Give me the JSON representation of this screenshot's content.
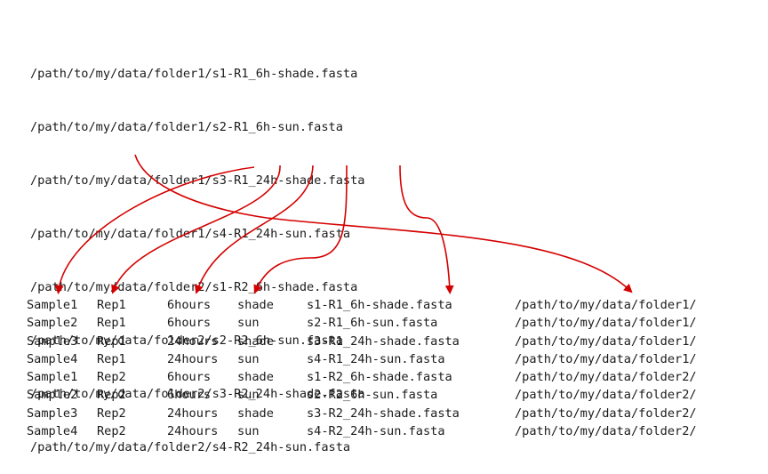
{
  "paths": [
    "/path/to/my/data/folder1/s1-R1_6h-shade.fasta",
    "/path/to/my/data/folder1/s2-R1_6h-sun.fasta",
    "/path/to/my/data/folder1/s3-R1_24h-shade.fasta",
    "/path/to/my/data/folder1/s4-R1_24h-sun.fasta",
    "/path/to/my/data/folder2/s1-R2_6h-shade.fasta",
    "/path/to/my/data/folder2/s2-R2_6h-sun.fasta",
    "/path/to/my/data/folder2/s3-R2_24h-shade.fasta",
    "/path/to/my/data/folder2/s4-R2_24h-sun.fasta"
  ],
  "table": [
    [
      "Sample1",
      "Rep1",
      "6hours",
      "shade",
      "s1-R1_6h-shade.fasta",
      "/path/to/my/data/folder1/"
    ],
    [
      "Sample2",
      "Rep1",
      "6hours",
      "sun",
      "s2-R1_6h-sun.fasta",
      "/path/to/my/data/folder1/"
    ],
    [
      "Sample3",
      "Rep1",
      "24hours",
      "shade",
      "s3-R1_24h-shade.fasta",
      "/path/to/my/data/folder1/"
    ],
    [
      "Sample4",
      "Rep1",
      "24hours",
      "sun",
      "s4-R1_24h-sun.fasta",
      "/path/to/my/data/folder1/"
    ],
    [
      "Sample1",
      "Rep2",
      "6hours",
      "shade",
      "s1-R2_6h-shade.fasta",
      "/path/to/my/data/folder2/"
    ],
    [
      "Sample2",
      "Rep2",
      "6hours",
      "sun",
      "s2-R2_6h-sun.fasta",
      "/path/to/my/data/folder2/"
    ],
    [
      "Sample3",
      "Rep2",
      "24hours",
      "shade",
      "s3-R2_24h-shade.fasta",
      "/path/to/my/data/folder2/"
    ],
    [
      "Sample4",
      "Rep2",
      "24hours",
      "sun",
      "s4-R2_24h-sun.fasta",
      "/path/to/my/data/folder2/"
    ]
  ],
  "colors": {
    "arrow": "#d40000",
    "text": "#1a1a1a"
  }
}
